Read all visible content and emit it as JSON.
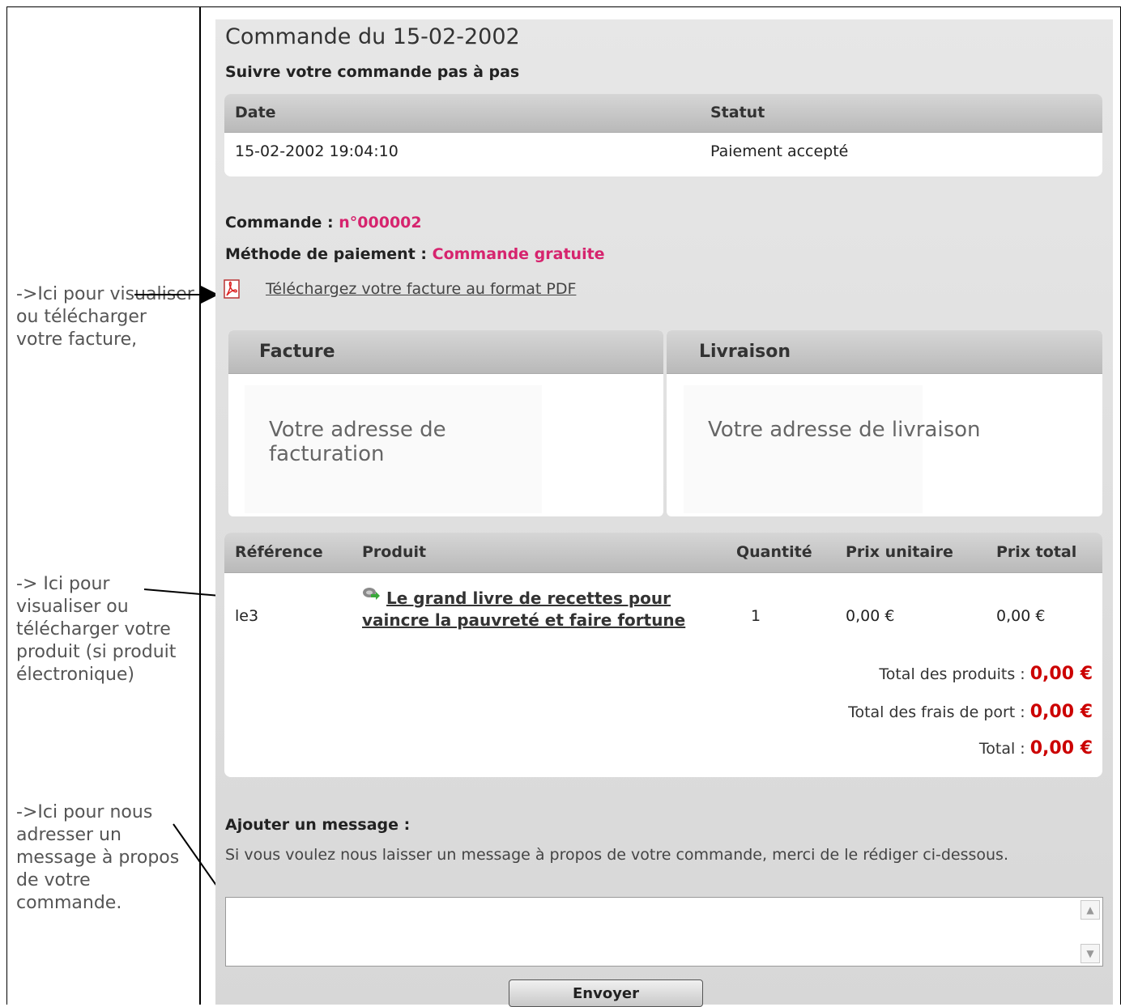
{
  "order": {
    "title": "Commande du 15-02-2002",
    "follow_heading": "Suivre votre commande pas à pas"
  },
  "history": {
    "columns": [
      "Date",
      "Statut"
    ],
    "rows": [
      {
        "date": "15-02-2002 19:04:10",
        "status": "Paiement accepté"
      }
    ]
  },
  "details": {
    "order_label": "Commande :",
    "order_number": "n°000002",
    "payment_label": "Méthode de paiement :",
    "payment_method": "Commande gratuite",
    "pdf_link": "Téléchargez votre facture au format PDF",
    "pdf_icon": "pdf-icon"
  },
  "addresses": {
    "billing_title": "Facture",
    "billing_text": "Votre adresse de facturation",
    "delivery_title": "Livraison",
    "delivery_text": "Votre adresse de livraison"
  },
  "products": {
    "columns": [
      "Référence",
      "Produit",
      "Quantité",
      "Prix unitaire",
      "Prix total"
    ],
    "rows": [
      {
        "reference": "le3",
        "product": "Le grand livre de recettes pour vaincre la pauvreté et faire fortune",
        "quantity": "1",
        "unit_price": "0,00 €",
        "total_price": "0,00 €",
        "icon": "download-icon"
      }
    ],
    "totals": {
      "products_label": "Total des produits :",
      "products_value": "0,00 €",
      "shipping_label": "Total des frais de port :",
      "shipping_value": "0,00 €",
      "total_label": "Total :",
      "total_value": "0,00 €"
    }
  },
  "message": {
    "title": "Ajouter un message :",
    "help": "Si vous voulez nous laisser un message à propos de votre commande, merci de le rédiger ci-dessous.",
    "value": "",
    "send_label": "Envoyer"
  },
  "annotations": {
    "invoice": "->Ici pour visualiser ou télécharger votre facture,",
    "product": "-> Ici pour visualiser ou télécharger votre produit (si produit électronique)",
    "message": "->Ici pour nous adresser un message à propos de votre commande."
  },
  "colors": {
    "accent_pink": "#d6246e",
    "price_red": "#cc0000",
    "panel_bg": "#dcdcdc"
  }
}
